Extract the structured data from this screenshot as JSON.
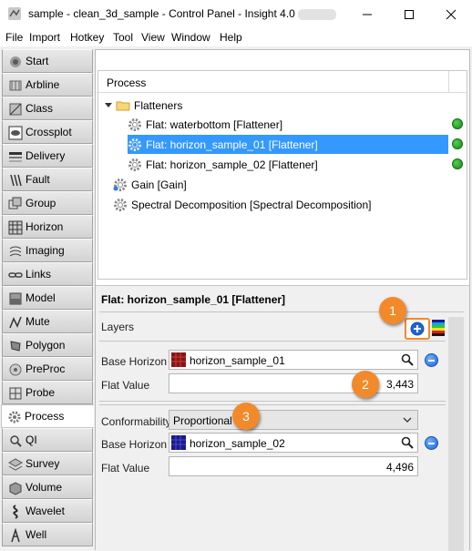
{
  "window": {
    "title": "sample - clean_3d_sample - Control Panel - Insight 4.0",
    "controls": {
      "minimize": "—",
      "maximize": "☐",
      "close": "✕"
    }
  },
  "menu": [
    "File",
    "Import",
    "Hotkey",
    "Tool",
    "View",
    "Window",
    "Help"
  ],
  "sidebar": {
    "active": "Process",
    "items": [
      {
        "label": "Start",
        "icon": "start-icon"
      },
      {
        "label": "Arbline",
        "icon": "arbline-icon"
      },
      {
        "label": "Class",
        "icon": "class-icon"
      },
      {
        "label": "Crossplot",
        "icon": "crossplot-icon"
      },
      {
        "label": "Delivery",
        "icon": "delivery-icon"
      },
      {
        "label": "Fault",
        "icon": "fault-icon"
      },
      {
        "label": "Group",
        "icon": "group-icon"
      },
      {
        "label": "Horizon",
        "icon": "horizon-icon"
      },
      {
        "label": "Imaging",
        "icon": "imaging-icon"
      },
      {
        "label": "Links",
        "icon": "links-icon"
      },
      {
        "label": "Model",
        "icon": "model-icon"
      },
      {
        "label": "Mute",
        "icon": "mute-icon"
      },
      {
        "label": "Polygon",
        "icon": "polygon-icon"
      },
      {
        "label": "PreProc",
        "icon": "preproc-icon"
      },
      {
        "label": "Probe",
        "icon": "probe-icon"
      },
      {
        "label": "Process",
        "icon": "process-icon"
      },
      {
        "label": "QI",
        "icon": "qi-icon"
      },
      {
        "label": "Survey",
        "icon": "survey-icon"
      },
      {
        "label": "Volume",
        "icon": "volume-icon"
      },
      {
        "label": "Wavelet",
        "icon": "wavelet-icon"
      },
      {
        "label": "Well",
        "icon": "well-icon"
      }
    ]
  },
  "tree": {
    "header": "Process",
    "folder": "Flatteners",
    "items": [
      {
        "label": "Flat: waterbottom [Flattener]",
        "status": "green"
      },
      {
        "label": "Flat: horizon_sample_01 [Flattener]",
        "status": "green",
        "selected": true
      },
      {
        "label": "Flat: horizon_sample_02 [Flattener]",
        "status": "green"
      }
    ],
    "others": [
      "Gain [Gain]",
      "Spectral Decomposition [Spectral Decomposition]"
    ]
  },
  "detail": {
    "title": "Flat: horizon_sample_01 [Flattener]",
    "layers_label": "Layers",
    "layer1": {
      "base_horizon_label": "Base Horizon",
      "base_horizon_value": "horizon_sample_01",
      "flat_value_label": "Flat Value",
      "flat_value": "3,443"
    },
    "conformability_label": "Conformability",
    "conformability_value": "Proportional",
    "layer2": {
      "base_horizon_label": "Base Horizon",
      "base_horizon_value": "horizon_sample_02",
      "flat_value_label": "Flat Value",
      "flat_value": "4,496"
    }
  },
  "callouts": [
    "1",
    "2",
    "3"
  ],
  "colors": {
    "selection": "#3399ff",
    "status_ok": "#22a022",
    "callout": "#f28a2b",
    "add_button": "#1e66d6"
  }
}
